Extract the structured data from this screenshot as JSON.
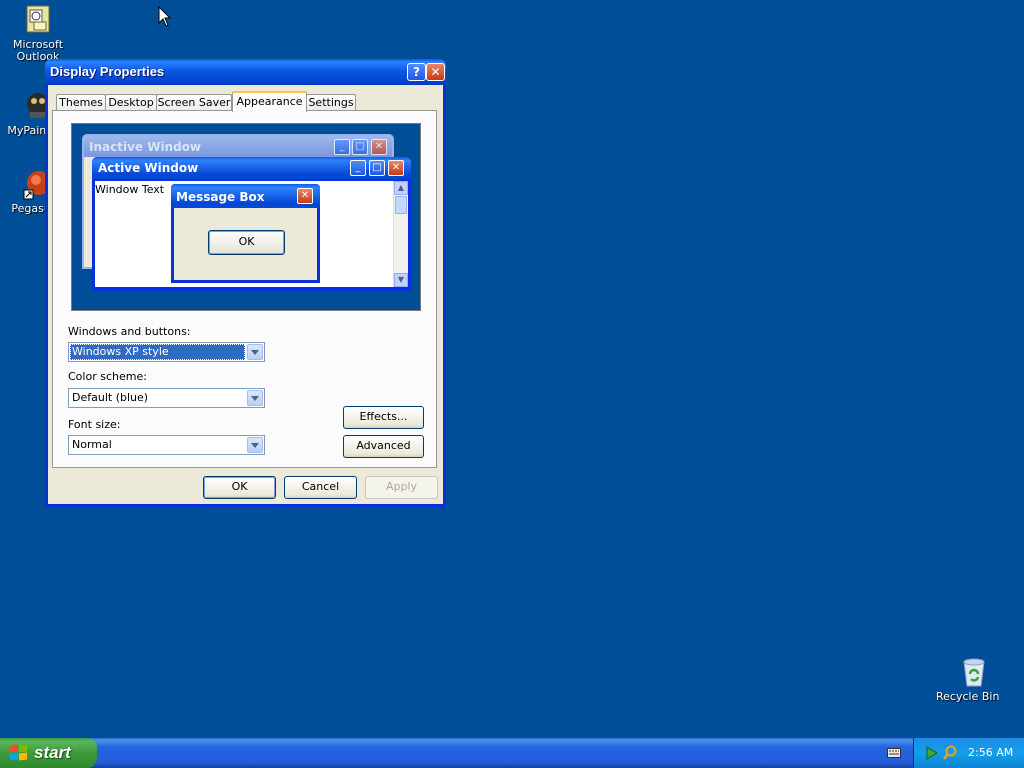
{
  "desktop": {
    "icons": [
      {
        "name": "outlook-icon",
        "label": "Microsoft Outlook"
      },
      {
        "name": "mypaint-icon",
        "label": "MyPaint"
      },
      {
        "name": "pegasus-icon",
        "label": "Pegasus"
      },
      {
        "name": "recycle-bin-icon",
        "label": "Recycle Bin"
      }
    ]
  },
  "window": {
    "title": "Display Properties",
    "help_glyph": "?",
    "close_glyph": "✕",
    "tabs": [
      {
        "label": "Themes"
      },
      {
        "label": "Desktop"
      },
      {
        "label": "Screen Saver"
      },
      {
        "label": "Appearance",
        "active": true
      },
      {
        "label": "Settings"
      }
    ]
  },
  "preview": {
    "inactive_title": "Inactive Window",
    "active_title": "Active Window",
    "window_text": "Window Text",
    "message_title": "Message Box",
    "message_ok": "OK"
  },
  "appearance": {
    "windows_buttons_label": "Windows and buttons:",
    "windows_buttons_value": "Windows XP style",
    "color_scheme_label": "Color scheme:",
    "color_scheme_value": "Default (blue)",
    "font_size_label": "Font size:",
    "font_size_value": "Normal",
    "effects_button": "Effects...",
    "advanced_button": "Advanced"
  },
  "dialog_buttons": {
    "ok": "OK",
    "cancel": "Cancel",
    "apply": "Apply"
  },
  "taskbar": {
    "start_label": "start",
    "clock": "2:56 AM"
  },
  "colors": {
    "desktop": "#004e98",
    "title_blue": "#0a58e0",
    "dialog_face": "#ece9d8"
  }
}
